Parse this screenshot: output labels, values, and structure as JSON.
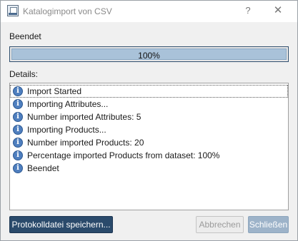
{
  "window": {
    "title": "Katalogimport von CSV",
    "help_glyph": "?",
    "close_glyph": "✕"
  },
  "status": {
    "label": "Beendet",
    "progress_percent": 100,
    "progress_text": "100%"
  },
  "details": {
    "label": "Details:",
    "items": [
      {
        "icon": "info-icon",
        "text": "Import Started"
      },
      {
        "icon": "info-icon",
        "text": "Importing Attributes..."
      },
      {
        "icon": "info-icon",
        "text": "Number imported Attributes: 5"
      },
      {
        "icon": "info-icon",
        "text": "Importing Products..."
      },
      {
        "icon": "info-icon",
        "text": "Number imported Products: 20"
      },
      {
        "icon": "info-icon",
        "text": "Percentage imported Products from dataset: 100%"
      },
      {
        "icon": "info-icon",
        "text": "Beendet"
      }
    ]
  },
  "buttons": {
    "save_log": "Protokolldatei speichern...",
    "cancel": "Abbrechen",
    "close": "Schließen"
  },
  "colors": {
    "primary_button": "#2a4a6b",
    "progress_fill": "#a9c2d9",
    "info_icon": "#4f7fbf"
  }
}
